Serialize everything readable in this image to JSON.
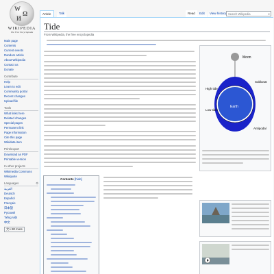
{
  "logo": {
    "wordmark": "WIKIPEDIA",
    "tagline": "The Free Encyclopedia"
  },
  "sidebar": {
    "nav": [
      "Main page",
      "Contents",
      "Current events",
      "Random article",
      "About Wikipedia",
      "Contact us",
      "Donate"
    ],
    "contribute_heading": "Contribute",
    "contribute": [
      "Help",
      "Learn to edit",
      "Community portal",
      "Recent changes",
      "Upload file"
    ],
    "tools_heading": "Tools",
    "tools": [
      "What links here",
      "Related changes",
      "Special pages",
      "Permanent link",
      "Page information",
      "Cite this page",
      "Wikidata item"
    ],
    "print_heading": "Print/export",
    "print": [
      "Download as PDF",
      "Printable version"
    ],
    "projects_heading": "In other projects",
    "projects": [
      "Wikimedia Commons",
      "Wikiquote"
    ],
    "languages_heading": "Languages",
    "languages": [
      "العربية",
      "Deutsch",
      "Español",
      "Français",
      "日本語",
      "Русский",
      "Tiếng Việt",
      "中文"
    ],
    "more_languages": "80 more"
  },
  "tabs": {
    "article": "Article",
    "talk": "Talk",
    "read": "Read",
    "edit": "Edit",
    "history": "View history"
  },
  "search": {
    "placeholder": "Search Wikipedia"
  },
  "article": {
    "title": "Tide",
    "subtitle": "From Wikipedia, the free encyclopedia"
  },
  "toc": {
    "title": "Contents",
    "hide_label": "[hide]"
  },
  "infobox": {
    "labels": {
      "moon": "Moon",
      "high_tide": "High tide",
      "low_tide": "Low tide",
      "sublunar": "Sublunar",
      "antipodal": "Antipodal",
      "earth": "Earth"
    }
  },
  "colors": {
    "link": "#0645ad",
    "tide_fill": "#1a23c9",
    "earth_fill": "#2c57d3"
  }
}
